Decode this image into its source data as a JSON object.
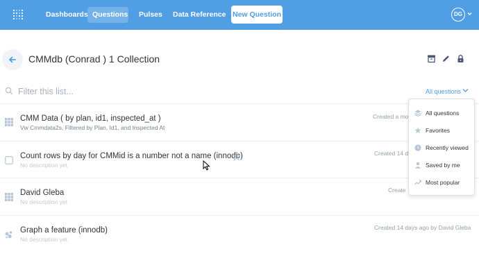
{
  "nav": {
    "items": [
      {
        "label": "Dashboards"
      },
      {
        "label": "Questions"
      },
      {
        "label": "Pulses"
      },
      {
        "label": "Data Reference"
      }
    ],
    "new_question_label": "New Question",
    "user_initials": "DG"
  },
  "collection": {
    "title": "CMMdb (Conrad ) 1 Collection"
  },
  "filter": {
    "placeholder": "Filter this list...",
    "sort_label": "All questions"
  },
  "questions": [
    {
      "title": "CMM Data ( by plan, id1, inspected_at )",
      "description": "Vw Cmmdata2s, Filtered by Plan, Id1, and Inspected At",
      "meta": "Created a mo",
      "icon": "grid-icon"
    },
    {
      "title": "Count rows by day for CMMid is a number not a name (innodb)",
      "description": "No description yet",
      "meta": "Created 14 d",
      "icon": "checkbox-icon"
    },
    {
      "title": "David Gleba",
      "description": "No description yet",
      "meta": "Create",
      "icon": "grid-icon"
    },
    {
      "title": "Graph a feature (innodb)",
      "description": "No description yet",
      "meta": "Created 14 days ago by David Gleba",
      "icon": "scatter-icon"
    }
  ],
  "sort_menu": {
    "items": [
      {
        "label": "All questions",
        "icon": "stack-icon"
      },
      {
        "label": "Favorites",
        "icon": "star-icon"
      },
      {
        "label": "Recently viewed",
        "icon": "clock-icon"
      },
      {
        "label": "Saved by me",
        "icon": "person-icon"
      },
      {
        "label": "Most popular",
        "icon": "trending-icon"
      }
    ]
  },
  "colors": {
    "brand": "#509ee3",
    "text_dark": "#2e353b",
    "text_muted": "#93a1ab",
    "icon_light": "#b8c7d6"
  }
}
